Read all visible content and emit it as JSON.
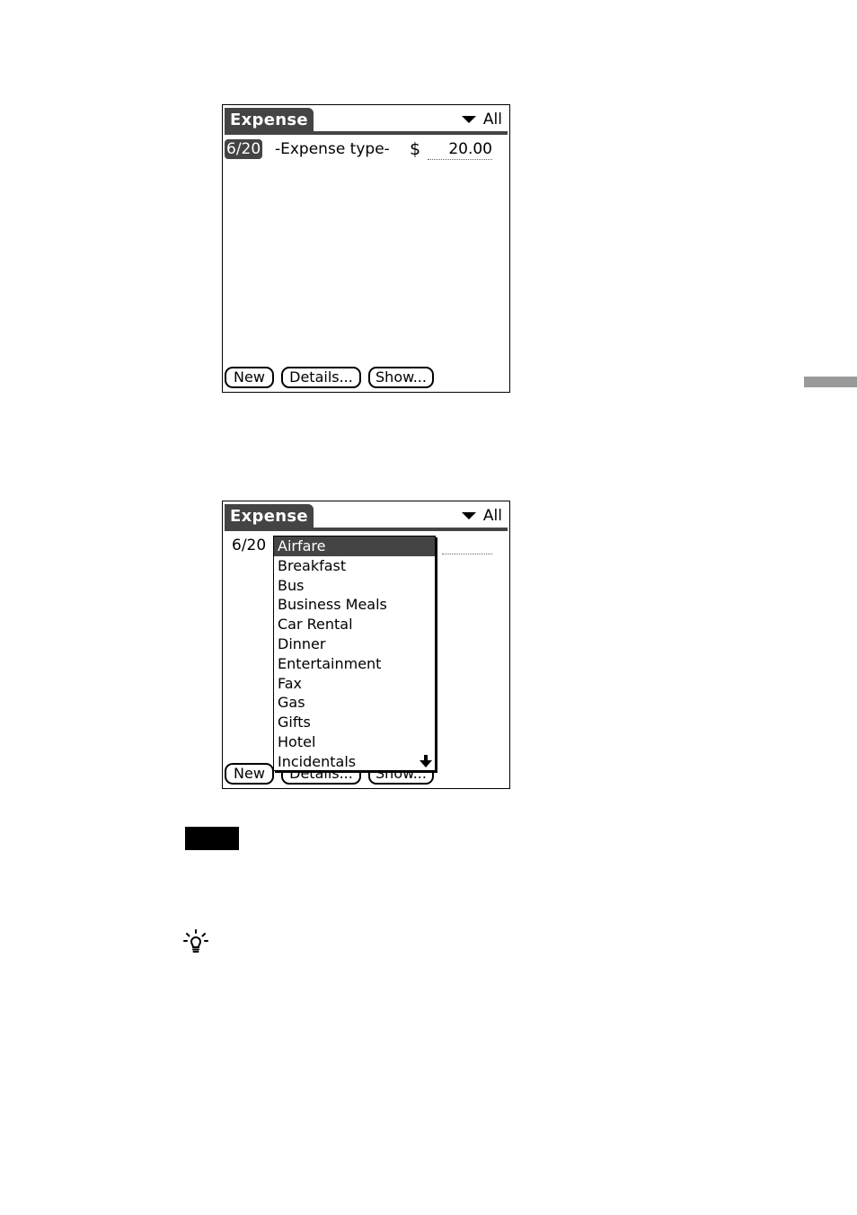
{
  "screen1": {
    "title": "Expense",
    "category": "All",
    "row": {
      "date": "6/20",
      "expense_type": "-Expense type-",
      "currency": "$",
      "amount": "20.00"
    },
    "buttons": {
      "new": "New",
      "details": "Details...",
      "show": "Show..."
    }
  },
  "screen2": {
    "title": "Expense",
    "category": "All",
    "row": {
      "date": "6/20"
    },
    "buttons": {
      "new": "New",
      "details": "Details...",
      "show": "Show..."
    },
    "popup": {
      "selected": "Airfare",
      "items": [
        "Airfare",
        "Breakfast",
        "Bus",
        "Business Meals",
        "Car Rental",
        "Dinner",
        "Entertainment",
        "Fax",
        "Gas",
        "Gifts",
        "Hotel",
        "Incidentals"
      ]
    }
  },
  "icons": {
    "category_trigger": "triangle-down-icon",
    "scroll": "arrow-down-icon",
    "tip": "lightbulb-icon"
  }
}
